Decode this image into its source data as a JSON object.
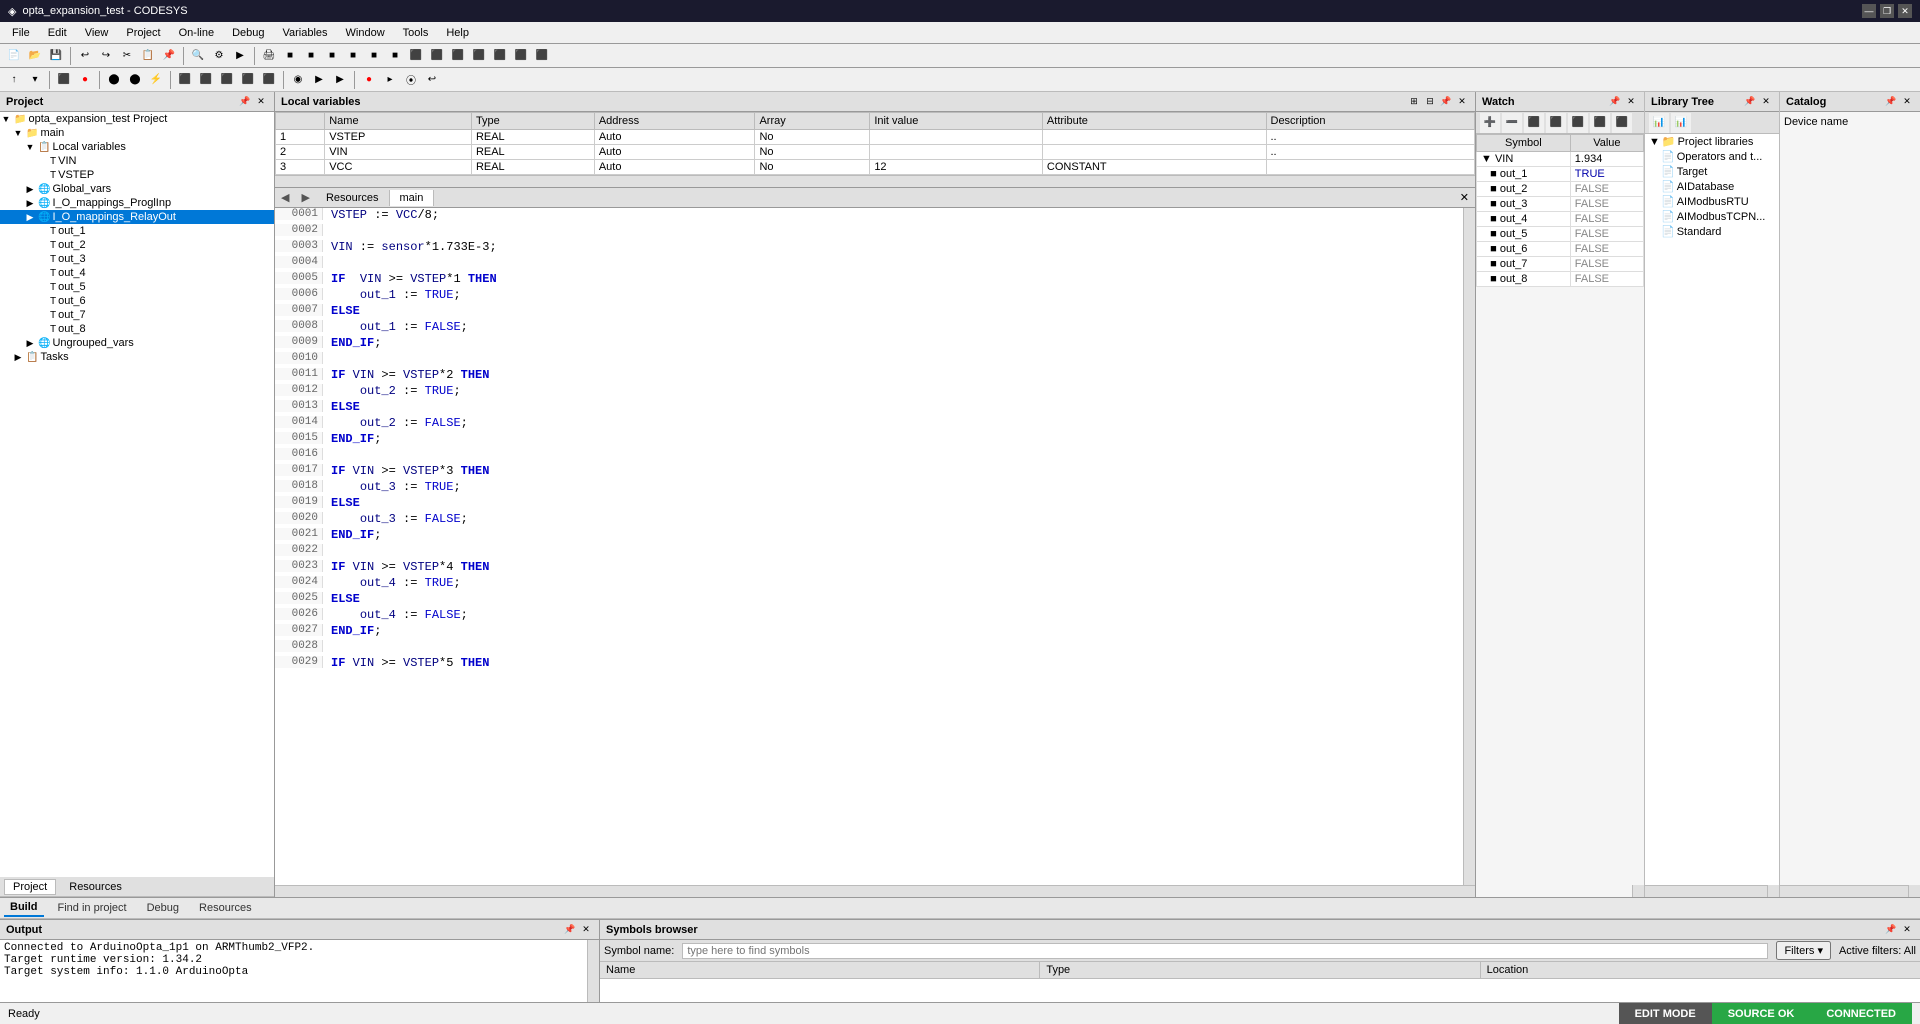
{
  "titleBar": {
    "title": "opta_expansion_test - CODESYS",
    "icon": "◈",
    "controls": [
      "—",
      "❐",
      "✕"
    ]
  },
  "menuBar": {
    "items": [
      "File",
      "Edit",
      "View",
      "Project",
      "On-line",
      "Debug",
      "Variables",
      "Window",
      "Tools",
      "Help"
    ]
  },
  "project": {
    "title": "Project",
    "tree": [
      {
        "level": 0,
        "label": "opta_expansion_test Project",
        "icon": "📁",
        "expanded": true
      },
      {
        "level": 1,
        "label": "main",
        "icon": "📁",
        "expanded": true
      },
      {
        "level": 2,
        "label": "Local variables",
        "icon": "📋",
        "expanded": true
      },
      {
        "level": 3,
        "label": "VIN",
        "icon": "T"
      },
      {
        "level": 3,
        "label": "VSTEP",
        "icon": "T"
      },
      {
        "level": 2,
        "label": "Global_vars",
        "icon": "🌐"
      },
      {
        "level": 2,
        "label": "I_O_mappings_ProglInp",
        "icon": "🌐"
      },
      {
        "level": 2,
        "label": "I_O_mappings_RelayOut",
        "icon": "🌐",
        "selected": true
      },
      {
        "level": 3,
        "label": "out_1",
        "icon": "T"
      },
      {
        "level": 3,
        "label": "out_2",
        "icon": "T"
      },
      {
        "level": 3,
        "label": "out_3",
        "icon": "T"
      },
      {
        "level": 3,
        "label": "out_4",
        "icon": "T"
      },
      {
        "level": 3,
        "label": "out_5",
        "icon": "T"
      },
      {
        "level": 3,
        "label": "out_6",
        "icon": "T"
      },
      {
        "level": 3,
        "label": "out_7",
        "icon": "T"
      },
      {
        "level": 3,
        "label": "out_8",
        "icon": "T"
      },
      {
        "level": 2,
        "label": "Ungrouped_vars",
        "icon": "🌐"
      },
      {
        "level": 1,
        "label": "Tasks",
        "icon": "📋"
      }
    ]
  },
  "localVariables": {
    "title": "Local variables",
    "columns": [
      "",
      "Name",
      "Type",
      "Address",
      "Array",
      "Init value",
      "Attribute",
      "Description"
    ],
    "rows": [
      {
        "num": "1",
        "name": "VSTEP",
        "type": "REAL",
        "address": "Auto",
        "array": "No",
        "initValue": "",
        "attribute": "",
        "description": ".."
      },
      {
        "num": "2",
        "name": "VIN",
        "type": "REAL",
        "address": "Auto",
        "array": "No",
        "initValue": "",
        "attribute": "",
        "description": ".."
      },
      {
        "num": "3",
        "name": "VCC",
        "type": "REAL",
        "address": "Auto",
        "array": "No",
        "initValue": "12",
        "attribute": "CONSTANT",
        "description": ""
      }
    ]
  },
  "codeEditor": {
    "tabs": [
      "Resources",
      "main"
    ],
    "activeTab": "main",
    "lines": [
      {
        "num": "0001",
        "content": "VSTEP := VCC/8;"
      },
      {
        "num": "0002",
        "content": ""
      },
      {
        "num": "0003",
        "content": "VIN := sensor*1.733E-3;"
      },
      {
        "num": "0004",
        "content": ""
      },
      {
        "num": "0005",
        "content": "IF  VIN >= VSTEP*1 THEN"
      },
      {
        "num": "0006",
        "content": "    out_1 := TRUE;"
      },
      {
        "num": "0007",
        "content": "ELSE"
      },
      {
        "num": "0008",
        "content": "    out_1 := FALSE;"
      },
      {
        "num": "0009",
        "content": "END_IF;"
      },
      {
        "num": "0010",
        "content": ""
      },
      {
        "num": "0011",
        "content": "IF VIN >= VSTEP*2 THEN"
      },
      {
        "num": "0012",
        "content": "    out_2 := TRUE;"
      },
      {
        "num": "0013",
        "content": "ELSE"
      },
      {
        "num": "0014",
        "content": "    out_2 := FALSE;"
      },
      {
        "num": "0015",
        "content": "END_IF;"
      },
      {
        "num": "0016",
        "content": ""
      },
      {
        "num": "0017",
        "content": "IF VIN >= VSTEP*3 THEN"
      },
      {
        "num": "0018",
        "content": "    out_3 := TRUE;"
      },
      {
        "num": "0019",
        "content": "ELSE"
      },
      {
        "num": "0020",
        "content": "    out_3 := FALSE;"
      },
      {
        "num": "0021",
        "content": "END_IF;"
      },
      {
        "num": "0022",
        "content": ""
      },
      {
        "num": "0023",
        "content": "IF VIN >= VSTEP*4 THEN"
      },
      {
        "num": "0024",
        "content": "    out_4 := TRUE;"
      },
      {
        "num": "0025",
        "content": "ELSE"
      },
      {
        "num": "0026",
        "content": "    out_4 := FALSE;"
      },
      {
        "num": "0027",
        "content": "END_IF;"
      },
      {
        "num": "0028",
        "content": ""
      },
      {
        "num": "0029",
        "content": "IF VIN >= VSTEP*5 THEN"
      }
    ]
  },
  "watch": {
    "title": "Watch",
    "columns": [
      "Symbol",
      "Value"
    ],
    "rows": [
      {
        "symbol": "VIN",
        "value": "1.934",
        "color": "#000",
        "indent": 0,
        "expanded": true
      },
      {
        "symbol": "out_1",
        "value": "TRUE",
        "color": "#00a",
        "indent": 1
      },
      {
        "symbol": "out_2",
        "value": "FALSE",
        "color": "#888",
        "indent": 1
      },
      {
        "symbol": "out_3",
        "value": "FALSE",
        "color": "#888",
        "indent": 1
      },
      {
        "symbol": "out_4",
        "value": "FALSE",
        "color": "#888",
        "indent": 1
      },
      {
        "symbol": "out_5",
        "value": "FALSE",
        "color": "#888",
        "indent": 1
      },
      {
        "symbol": "out_6",
        "value": "FALSE",
        "color": "#888",
        "indent": 1
      },
      {
        "symbol": "out_7",
        "value": "FALSE",
        "color": "#888",
        "indent": 1
      },
      {
        "symbol": "out_8",
        "value": "FALSE",
        "color": "#888",
        "indent": 1
      }
    ]
  },
  "libraryTree": {
    "title": "Library Tree",
    "toolbar": [
      "📊",
      "📊"
    ],
    "items": [
      {
        "label": "Project libraries",
        "level": 0,
        "expanded": true
      },
      {
        "label": "Operators and t...",
        "level": 1
      },
      {
        "label": "Target",
        "level": 1
      },
      {
        "label": "AIDatabase",
        "level": 1
      },
      {
        "label": "AIModbusRTU",
        "level": 1
      },
      {
        "label": "AIModbusTCPN...",
        "level": 1
      },
      {
        "label": "Standard",
        "level": 1
      }
    ]
  },
  "catalog": {
    "title": "Catalog",
    "deviceNameLabel": "Device name"
  },
  "output": {
    "title": "Output",
    "tabs": [
      "Resources"
    ],
    "content": [
      "Connected to ArduinoOpta_1p1 on ARMThumb2_VFP2.",
      "Target runtime version: 1.34.2",
      "Target system info: 1.1.0 ArduinoOpta"
    ]
  },
  "symbolsBrowser": {
    "title": "Symbols browser",
    "searchPlaceholder": "type here to find symbols",
    "filtersLabel": "Filters ▾",
    "activeFilters": "Active filters: All",
    "columns": [
      "Name",
      "Type",
      "Location"
    ]
  },
  "bottomTabs": {
    "items": [
      "Build",
      "Find in project",
      "Debug",
      "Resources"
    ]
  },
  "statusBar": {
    "text": "Ready",
    "editMode": "EDIT MODE",
    "sourceOk": "SOURCE OK",
    "connected": "CONNECTED"
  },
  "projectNavTabs": {
    "items": [
      "Project",
      "Resources"
    ]
  }
}
